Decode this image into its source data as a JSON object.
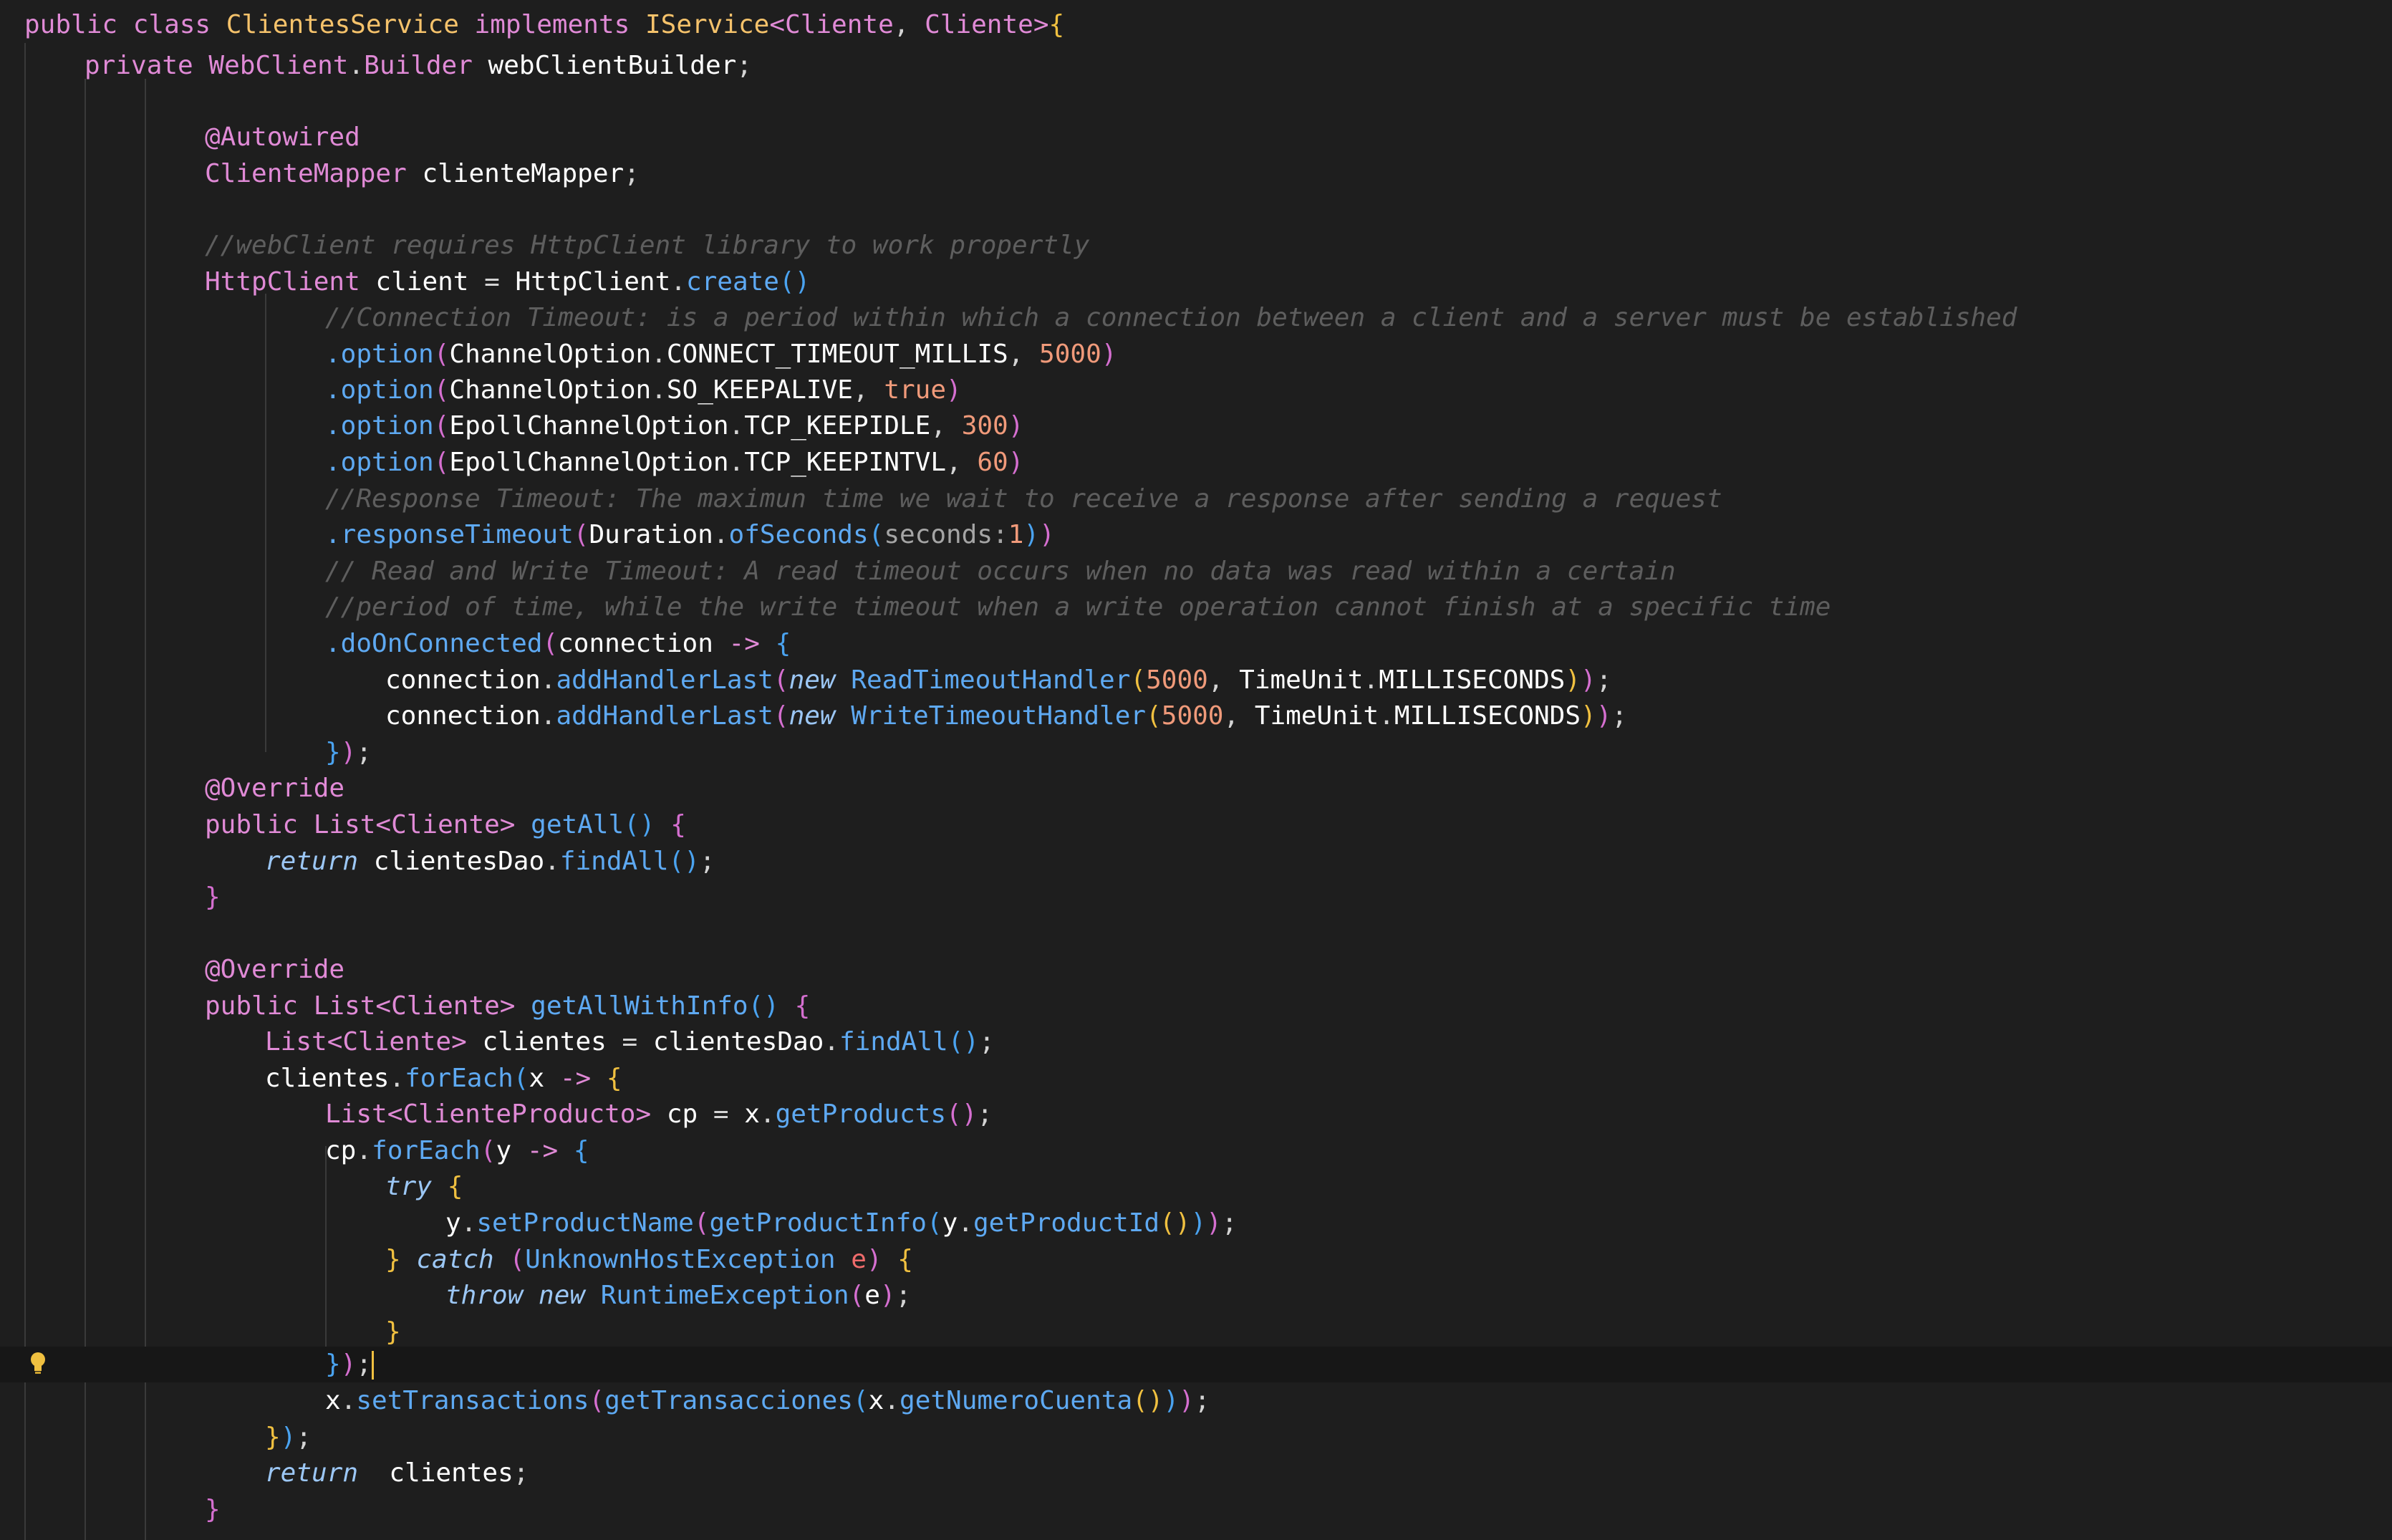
{
  "editor": {
    "language": "java",
    "theme_colors": {
      "background": "#1e1e1e",
      "keyword": "#e08ad6",
      "class_name": "#f5c26b",
      "function": "#5ea9f2",
      "number": "#f09a7a",
      "comment": "#5e5e5e"
    },
    "gutter_icon": "lightbulb-icon",
    "lines": [
      "public class ClientesService implements IService<Cliente, Cliente>{",
      "    private WebClient.Builder webClientBuilder;",
      "",
      "        @Autowired",
      "        ClienteMapper clienteMapper;",
      "",
      "        //webClient requires HttpClient library to work propertly",
      "        HttpClient client = HttpClient.create()",
      "                //Connection Timeout: is a period within which a connection between a client and a server must be established",
      "                .option(ChannelOption.CONNECT_TIMEOUT_MILLIS, 5000)",
      "                .option(ChannelOption.SO_KEEPALIVE, true)",
      "                .option(EpollChannelOption.TCP_KEEPIDLE, 300)",
      "                .option(EpollChannelOption.TCP_KEEPINTVL, 60)",
      "                //Response Timeout: The maximun time we wait to receive a response after sending a request",
      "                .responseTimeout(Duration.ofSeconds(seconds:1))",
      "                // Read and Write Timeout: A read timeout occurs when no data was read within a certain",
      "                //period of time, while the write timeout when a write operation cannot finish at a specific time",
      "                .doOnConnected(connection -> {",
      "                    connection.addHandlerLast(new ReadTimeoutHandler(5000, TimeUnit.MILLISECONDS));",
      "                    connection.addHandlerLast(new WriteTimeoutHandler(5000, TimeUnit.MILLISECONDS));",
      "                });",
      "        @Override",
      "        public List<Cliente> getAll() {",
      "            return clientesDao.findAll();",
      "        }",
      "",
      "        @Override",
      "        public List<Cliente> getAllWithInfo() {",
      "            List<Cliente> clientes = clientesDao.findAll();",
      "            clientes.forEach(x -> {",
      "                List<ClienteProducto> cp = x.getProducts();",
      "                cp.forEach(y -> {",
      "                    try {",
      "                        y.setProductName(getProductInfo(y.getProductId()));",
      "                    } catch (UnknownHostException e) {",
      "                        throw new RuntimeException(e);",
      "                    }",
      "                });",
      "                x.setTransactions(getTransacciones(x.getNumeroCuenta()));",
      "            });",
      "            return  clientes;",
      "        }"
    ]
  }
}
